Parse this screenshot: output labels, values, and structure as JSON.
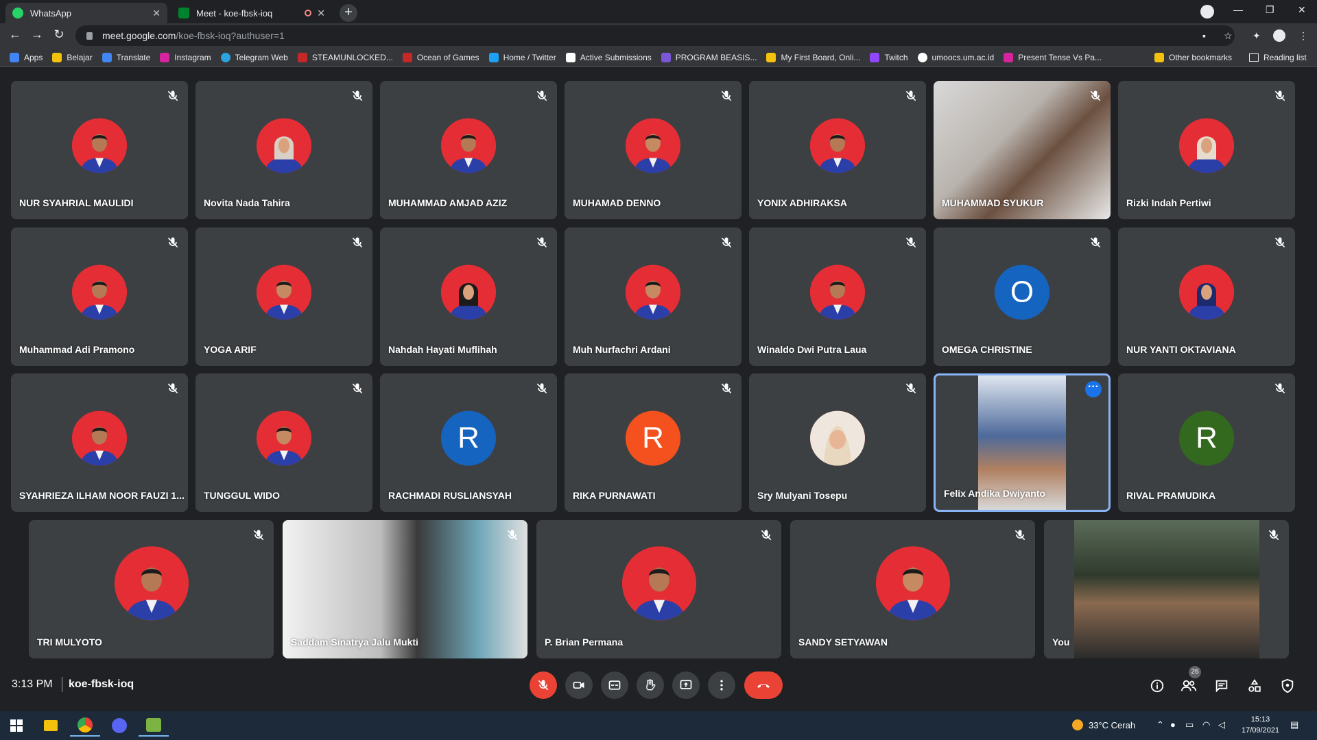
{
  "browser": {
    "tabs": [
      {
        "label": "WhatsApp",
        "favicon_color": "#25d366"
      },
      {
        "label": "Meet - koe-fbsk-ioq",
        "favicon_color": "#00832d"
      }
    ],
    "url_host": "meet.google.com",
    "url_path": "/koe-fbsk-ioq?authuser=1",
    "bookmarks": [
      {
        "label": "Apps",
        "color": "#4285f4"
      },
      {
        "label": "Belajar",
        "color": "#f4c20d"
      },
      {
        "label": "Translate",
        "color": "#4285f4"
      },
      {
        "label": "Instagram",
        "color": "#d6249f"
      },
      {
        "label": "Telegram Web",
        "color": "#2aa3df"
      },
      {
        "label": "STEAMUNLOCKED...",
        "color": "#c62828"
      },
      {
        "label": "Ocean of Games",
        "color": "#c62828"
      },
      {
        "label": "Home / Twitter",
        "color": "#1da1f2"
      },
      {
        "label": "Active Submissions",
        "color": "#ffffff"
      },
      {
        "label": "PROGRAM BEASIS...",
        "color": "#7b57d8"
      },
      {
        "label": "My First Board, Onli...",
        "color": "#f4c20d"
      },
      {
        "label": "Twitch",
        "color": "#9146ff"
      },
      {
        "label": "umoocs.um.ac.id",
        "color": "#ffffff"
      },
      {
        "label": "Present Tense Vs Pa...",
        "color": "#d6249f"
      }
    ],
    "other_bookmarks": "Other bookmarks",
    "reading_list": "Reading list"
  },
  "participants_row1": [
    {
      "name": "NUR SYAHRIAL MAULIDI",
      "kind": "photo"
    },
    {
      "name": "Novita Nada Tahira",
      "kind": "photo"
    },
    {
      "name": "MUHAMMAD AMJAD AZIZ",
      "kind": "photo"
    },
    {
      "name": "MUHAMAD DENNO",
      "kind": "photo"
    },
    {
      "name": "YONIX ADHIRAKSA",
      "kind": "photo"
    },
    {
      "name": "MUHAMMAD SYUKUR",
      "kind": "video"
    },
    {
      "name": "Rizki Indah Pertiwi",
      "kind": "photo"
    }
  ],
  "participants_row2": [
    {
      "name": "Muhammad Adi Pramono",
      "kind": "photo"
    },
    {
      "name": "YOGA ARIF",
      "kind": "photo"
    },
    {
      "name": "Nahdah Hayati Muflihah",
      "kind": "photo"
    },
    {
      "name": "Muh Nurfachri Ardani",
      "kind": "photo"
    },
    {
      "name": "Winaldo Dwi Putra Laua",
      "kind": "photo"
    },
    {
      "name": "OMEGA CHRISTINE",
      "kind": "letter",
      "letter": "O",
      "color": "#1565c0"
    },
    {
      "name": "NUR YANTI OKTAVIANA",
      "kind": "photo"
    }
  ],
  "participants_row3": [
    {
      "name": "SYAHRIEZA ILHAM NOOR FAUZI 1...",
      "kind": "photo"
    },
    {
      "name": "TUNGGUL WIDO",
      "kind": "photo"
    },
    {
      "name": "RACHMADI RUSLIANSYAH",
      "kind": "letter",
      "letter": "R",
      "color": "#1565c0"
    },
    {
      "name": "RIKA PURNAWATI",
      "kind": "letter",
      "letter": "R",
      "color": "#f4511e"
    },
    {
      "name": "Sry Mulyani Tosepu",
      "kind": "photo-light"
    },
    {
      "name": "Felix Andika Dwiyanto",
      "kind": "video-active"
    },
    {
      "name": "RIVAL PRAMUDIKA",
      "kind": "letter",
      "letter": "R",
      "color": "#33691e"
    }
  ],
  "participants_row4": [
    {
      "name": "TRI MULYOTO",
      "kind": "photo"
    },
    {
      "name": "Saddam Sinatrya Jalu Mukti",
      "kind": "video"
    },
    {
      "name": "P. Brian Permana",
      "kind": "photo"
    },
    {
      "name": "SANDY SETYAWAN",
      "kind": "photo"
    },
    {
      "name": "You",
      "kind": "video"
    }
  ],
  "meeting": {
    "time": "3:13 PM",
    "code": "koe-fbsk-ioq",
    "participant_count": "26"
  },
  "taskbar": {
    "weather": "33°C  Cerah",
    "clock_time": "15:13",
    "clock_date": "17/09/2021"
  }
}
